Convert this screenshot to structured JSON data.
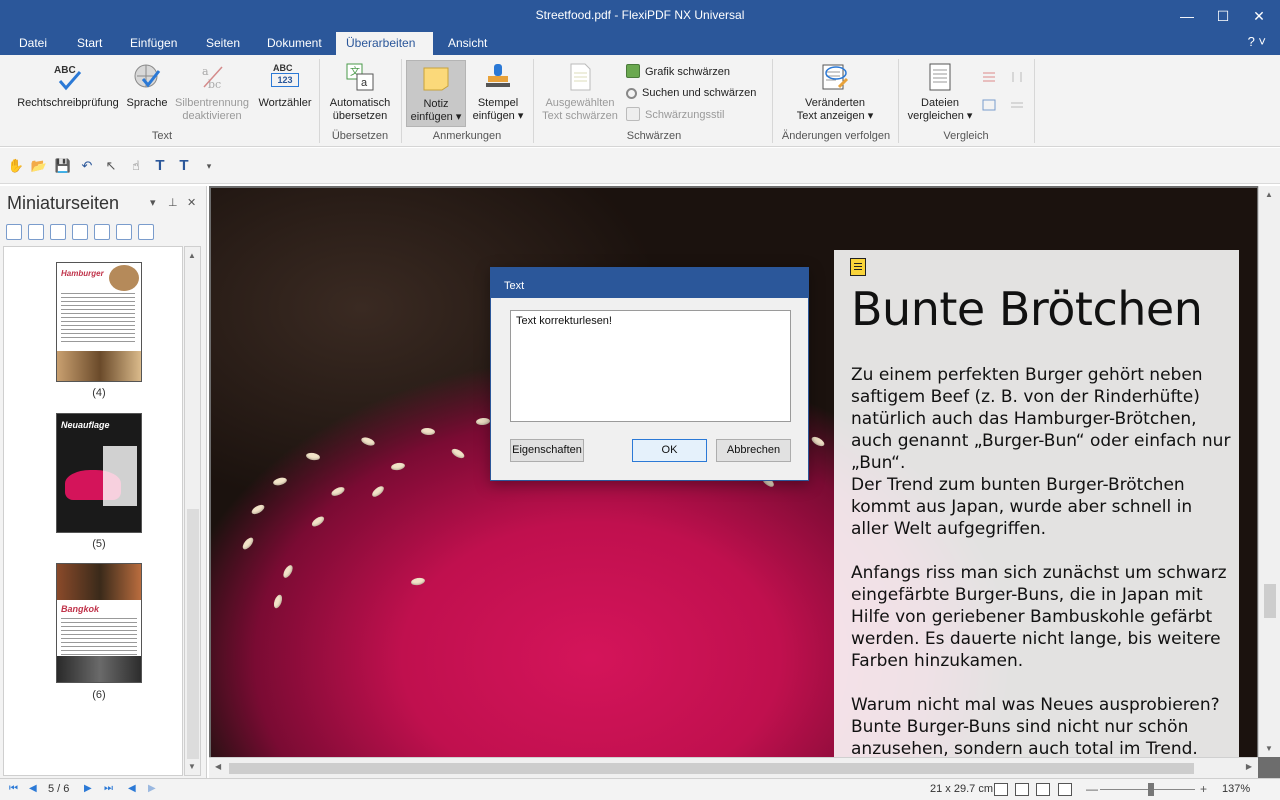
{
  "window": {
    "title": "Streetfood.pdf - FlexiPDF NX Universal",
    "minimize": "—",
    "maximize": "☐",
    "close": "✕"
  },
  "menu": {
    "tabs": [
      "Datei",
      "Start",
      "Einfügen",
      "Seiten",
      "Dokument",
      "Überarbeiten",
      "Ansicht"
    ],
    "active": "Überarbeiten",
    "help": "? ˅"
  },
  "ribbon": {
    "text_group": {
      "label": "Text",
      "spellcheck": "Rechtschreibprüfung",
      "language": "Sprache",
      "hyphen_line1": "Silbentrennung",
      "hyphen_line2": "deaktivieren",
      "wordcount": "Wortzähler",
      "abc": "ABC",
      "abc123": "123"
    },
    "translate_group": {
      "label": "Übersetzen",
      "line1": "Automatisch",
      "line2": "übersetzen"
    },
    "annot_group": {
      "label": "Anmerkungen",
      "note_line1": "Notiz",
      "note_line2": "einfügen",
      "stamp_line1": "Stempel",
      "stamp_line2": "einfügen"
    },
    "redact_group": {
      "label": "Schwärzen",
      "selected_line1": "Ausgewählten",
      "selected_line2": "Text schwärzen",
      "graphic": "Grafik schwärzen",
      "search": "Suchen und schwärzen",
      "style": "Schwärzungsstil"
    },
    "track_group": {
      "label": "Änderungen verfolgen",
      "line1": "Veränderten",
      "line2": "Text anzeigen"
    },
    "compare_group": {
      "label": "Vergleich",
      "line1": "Dateien",
      "line2": "vergleichen"
    }
  },
  "sidebar": {
    "title": "Miniaturseiten",
    "pin": "▾",
    "close": "✕",
    "thumbs": [
      {
        "label": "(4)",
        "heading": "Hamburger"
      },
      {
        "label": "(5)",
        "heading": "Neuauflage"
      },
      {
        "label": "(6)",
        "heading": "Bangkok"
      }
    ]
  },
  "document": {
    "heading": "Bunte Brötchen",
    "paragraphs": [
      "Zu einem perfekten Burger gehört neben saftigem Beef (z. B. von der Rinderhüfte) natürlich auch das Hamburger-Brötchen, auch genannt „Burger-Bun“ oder einfach nur „Bun“.",
      "Der Trend zum bunten Burger-Brötchen kommt aus Japan, wurde aber schnell in aller Welt aufgegriffen.",
      "Anfangs riss man sich zunächst um schwarz eingefärbte Burger-Buns, die in Japan mit Hilfe von geriebener Bambuskohle gefärbt werden. Es dauerte nicht lange, bis weitere Farben hinzukamen.",
      "Warum nicht mal was Neues ausprobieren? Bunte Burger-Buns sind nicht nur schön anzusehen, sondern auch total im Trend."
    ]
  },
  "dialog": {
    "title": "Text",
    "content": "Text korrekturlesen!",
    "properties_button": "Eigenschaften",
    "ok_button": "OK",
    "cancel_button": "Abbrechen"
  },
  "statusbar": {
    "page": "5 / 6",
    "dimensions": "21 x 29.7 cm",
    "zoom": "137%",
    "zoom_out": "—",
    "zoom_in": "+"
  }
}
